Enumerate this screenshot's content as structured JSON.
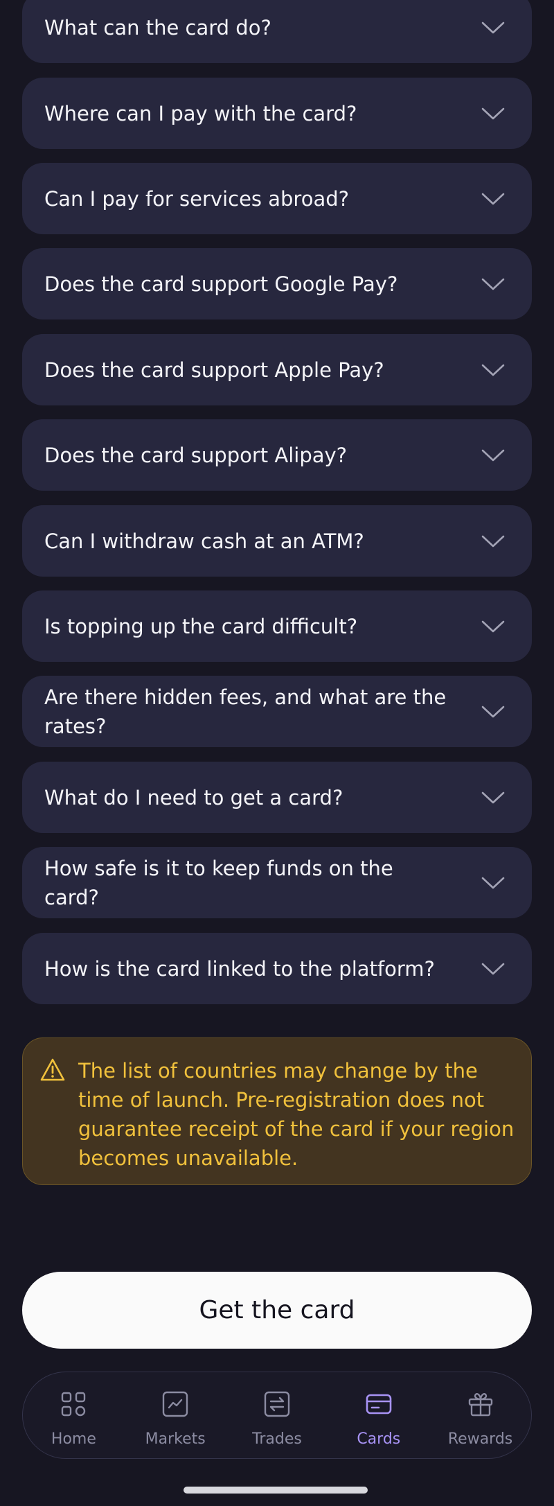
{
  "faq": {
    "items": [
      {
        "question": "What can the card do?"
      },
      {
        "question": "Where can I pay with the card?"
      },
      {
        "question": "Can I pay for services abroad?"
      },
      {
        "question": "Does the card support Google Pay?"
      },
      {
        "question": "Does the card support Apple Pay?"
      },
      {
        "question": "Does the card support Alipay?"
      },
      {
        "question": "Can I withdraw cash at an ATM?"
      },
      {
        "question": "Is topping up the card difficult?"
      },
      {
        "question": "Are there hidden fees, and what are the rates?"
      },
      {
        "question": "What do I need to get a card?"
      },
      {
        "question": "How safe is it to keep funds on the card?"
      },
      {
        "question": "How is the card linked to the platform?"
      }
    ]
  },
  "notice": {
    "icon": "warning-triangle-icon",
    "text": "The list of countries may change by the time of launch. Pre-registration does not guarantee receipt of the card if your region becomes unavailable."
  },
  "cta": {
    "label": "Get the card"
  },
  "nav": {
    "items": [
      {
        "label": "Home",
        "icon": "home-grid-icon",
        "active": false
      },
      {
        "label": "Markets",
        "icon": "chart-line-icon",
        "active": false
      },
      {
        "label": "Trades",
        "icon": "swap-arrows-icon",
        "active": false
      },
      {
        "label": "Cards",
        "icon": "credit-card-icon",
        "active": true
      },
      {
        "label": "Rewards",
        "icon": "gift-icon",
        "active": false
      }
    ]
  },
  "colors": {
    "background": "#171622",
    "card": "#27273e",
    "accent": "#a893f5",
    "warning_text": "#f1c13c",
    "warning_bg": "#433420"
  }
}
